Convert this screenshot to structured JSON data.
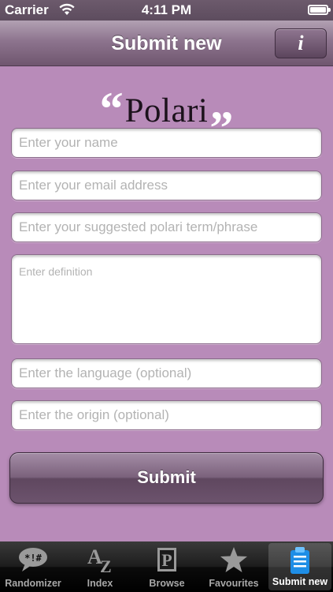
{
  "status_bar": {
    "carrier": "Carrier",
    "time": "4:11 PM",
    "icons": [
      "wifi-icon",
      "battery-icon"
    ]
  },
  "nav": {
    "title": "Submit new",
    "info_label": "i"
  },
  "logo": {
    "open_quote": "“",
    "word": "Polari",
    "close_quote": "”"
  },
  "form": {
    "name_placeholder": "Enter your name",
    "email_placeholder": "Enter your email address",
    "term_placeholder": "Enter your suggested polari term/phrase",
    "definition_placeholder": "Enter definition",
    "language_placeholder": "Enter the language (optional)",
    "origin_placeholder": "Enter the origin (optional)",
    "name_value": "",
    "email_value": "",
    "term_value": "",
    "definition_value": "",
    "language_value": "",
    "origin_value": "",
    "submit_label": "Submit"
  },
  "tabs": [
    {
      "label": "Randomizer",
      "icon": "speech-bubble-icon",
      "glyph": "*!#",
      "active": false
    },
    {
      "label": "Index",
      "icon": "az-index-icon",
      "glyph": "AZ",
      "active": false
    },
    {
      "label": "Browse",
      "icon": "book-p-icon",
      "glyph": "P",
      "active": false
    },
    {
      "label": "Favourites",
      "icon": "star-icon",
      "glyph": "★",
      "active": false
    },
    {
      "label": "Submit new",
      "icon": "clipboard-icon",
      "glyph": "",
      "active": true
    }
  ],
  "colors": {
    "background": "#b88bb9",
    "nav_bar": "#8d748e",
    "tab_bar": "#000000",
    "active_icon": "#1e8ee6"
  }
}
